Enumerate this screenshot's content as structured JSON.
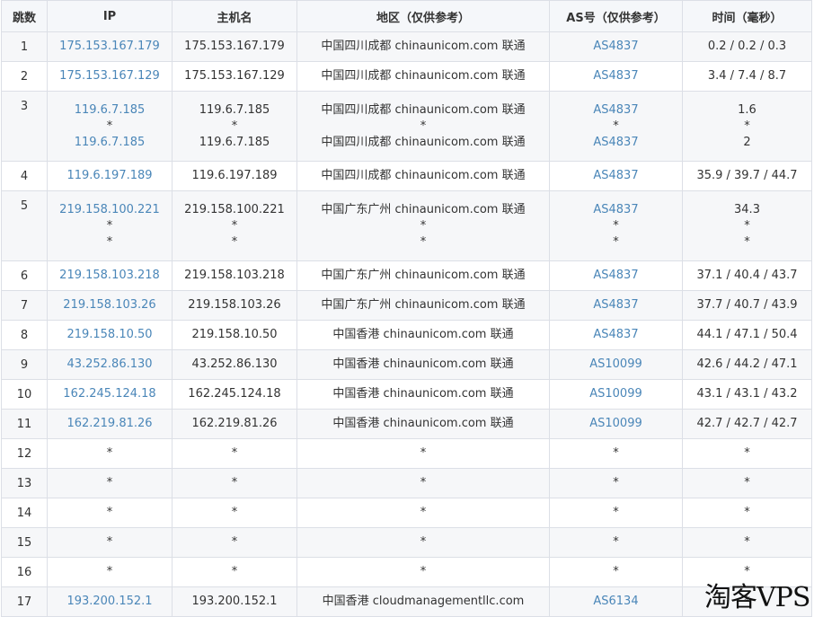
{
  "table": {
    "columns": [
      "跳数",
      "IP",
      "主机名",
      "地区（仅供参考）",
      "AS号（仅供参考）",
      "时间（毫秒）"
    ],
    "rows": [
      {
        "hop": "1",
        "ip": [
          "175.153.167.179"
        ],
        "host": [
          "175.153.167.179"
        ],
        "region": [
          "中国四川成都 chinaunicom.com 联通"
        ],
        "as": [
          "AS4837"
        ],
        "time": [
          "0.2 / 0.2 / 0.3"
        ]
      },
      {
        "hop": "2",
        "ip": [
          "175.153.167.129"
        ],
        "host": [
          "175.153.167.129"
        ],
        "region": [
          "中国四川成都 chinaunicom.com 联通"
        ],
        "as": [
          "AS4837"
        ],
        "time": [
          "3.4 / 7.4 / 8.7"
        ]
      },
      {
        "hop": "3",
        "ip": [
          "119.6.7.185",
          "*",
          "119.6.7.185"
        ],
        "host": [
          "119.6.7.185",
          "*",
          "119.6.7.185"
        ],
        "region": [
          "中国四川成都 chinaunicom.com 联通",
          "*",
          "中国四川成都 chinaunicom.com 联通"
        ],
        "as": [
          "AS4837",
          "*",
          "AS4837"
        ],
        "time": [
          "1.6",
          "*",
          "2"
        ]
      },
      {
        "hop": "4",
        "ip": [
          "119.6.197.189"
        ],
        "host": [
          "119.6.197.189"
        ],
        "region": [
          "中国四川成都 chinaunicom.com 联通"
        ],
        "as": [
          "AS4837"
        ],
        "time": [
          "35.9 / 39.7 / 44.7"
        ]
      },
      {
        "hop": "5",
        "ip": [
          "219.158.100.221",
          "*",
          "*"
        ],
        "host": [
          "219.158.100.221",
          "*",
          "*"
        ],
        "region": [
          "中国广东广州 chinaunicom.com 联通",
          "*",
          "*"
        ],
        "as": [
          "AS4837",
          "*",
          "*"
        ],
        "time": [
          "34.3",
          "*",
          "*"
        ]
      },
      {
        "hop": "6",
        "ip": [
          "219.158.103.218"
        ],
        "host": [
          "219.158.103.218"
        ],
        "region": [
          "中国广东广州 chinaunicom.com 联通"
        ],
        "as": [
          "AS4837"
        ],
        "time": [
          "37.1 / 40.4 / 43.7"
        ]
      },
      {
        "hop": "7",
        "ip": [
          "219.158.103.26"
        ],
        "host": [
          "219.158.103.26"
        ],
        "region": [
          "中国广东广州 chinaunicom.com 联通"
        ],
        "as": [
          "AS4837"
        ],
        "time": [
          "37.7 / 40.7 / 43.9"
        ]
      },
      {
        "hop": "8",
        "ip": [
          "219.158.10.50"
        ],
        "host": [
          "219.158.10.50"
        ],
        "region": [
          "中国香港 chinaunicom.com 联通"
        ],
        "as": [
          "AS4837"
        ],
        "time": [
          "44.1 / 47.1 / 50.4"
        ]
      },
      {
        "hop": "9",
        "ip": [
          "43.252.86.130"
        ],
        "host": [
          "43.252.86.130"
        ],
        "region": [
          "中国香港 chinaunicom.com 联通"
        ],
        "as": [
          "AS10099"
        ],
        "time": [
          "42.6 / 44.2 / 47.1"
        ]
      },
      {
        "hop": "10",
        "ip": [
          "162.245.124.18"
        ],
        "host": [
          "162.245.124.18"
        ],
        "region": [
          "中国香港 chinaunicom.com 联通"
        ],
        "as": [
          "AS10099"
        ],
        "time": [
          "43.1 / 43.1 / 43.2"
        ]
      },
      {
        "hop": "11",
        "ip": [
          "162.219.81.26"
        ],
        "host": [
          "162.219.81.26"
        ],
        "region": [
          "中国香港 chinaunicom.com 联通"
        ],
        "as": [
          "AS10099"
        ],
        "time": [
          "42.7 / 42.7 / 42.7"
        ]
      },
      {
        "hop": "12",
        "ip": [
          "*"
        ],
        "host": [
          "*"
        ],
        "region": [
          "*"
        ],
        "as": [
          "*"
        ],
        "time": [
          "*"
        ]
      },
      {
        "hop": "13",
        "ip": [
          "*"
        ],
        "host": [
          "*"
        ],
        "region": [
          "*"
        ],
        "as": [
          "*"
        ],
        "time": [
          "*"
        ]
      },
      {
        "hop": "14",
        "ip": [
          "*"
        ],
        "host": [
          "*"
        ],
        "region": [
          "*"
        ],
        "as": [
          "*"
        ],
        "time": [
          "*"
        ]
      },
      {
        "hop": "15",
        "ip": [
          "*"
        ],
        "host": [
          "*"
        ],
        "region": [
          "*"
        ],
        "as": [
          "*"
        ],
        "time": [
          "*"
        ]
      },
      {
        "hop": "16",
        "ip": [
          "*"
        ],
        "host": [
          "*"
        ],
        "region": [
          "*"
        ],
        "as": [
          "*"
        ],
        "time": [
          "*"
        ]
      },
      {
        "hop": "17",
        "ip": [
          "193.200.152.1"
        ],
        "host": [
          "193.200.152.1"
        ],
        "region": [
          "中国香港 cloudmanagementllc.com"
        ],
        "as": [
          "AS6134"
        ],
        "time": [
          "*"
        ]
      }
    ]
  },
  "watermark": "淘客VPS",
  "colors": {
    "link": "#4a86b8",
    "border": "#dcdfe6",
    "stripe": "#f6f7f9"
  }
}
